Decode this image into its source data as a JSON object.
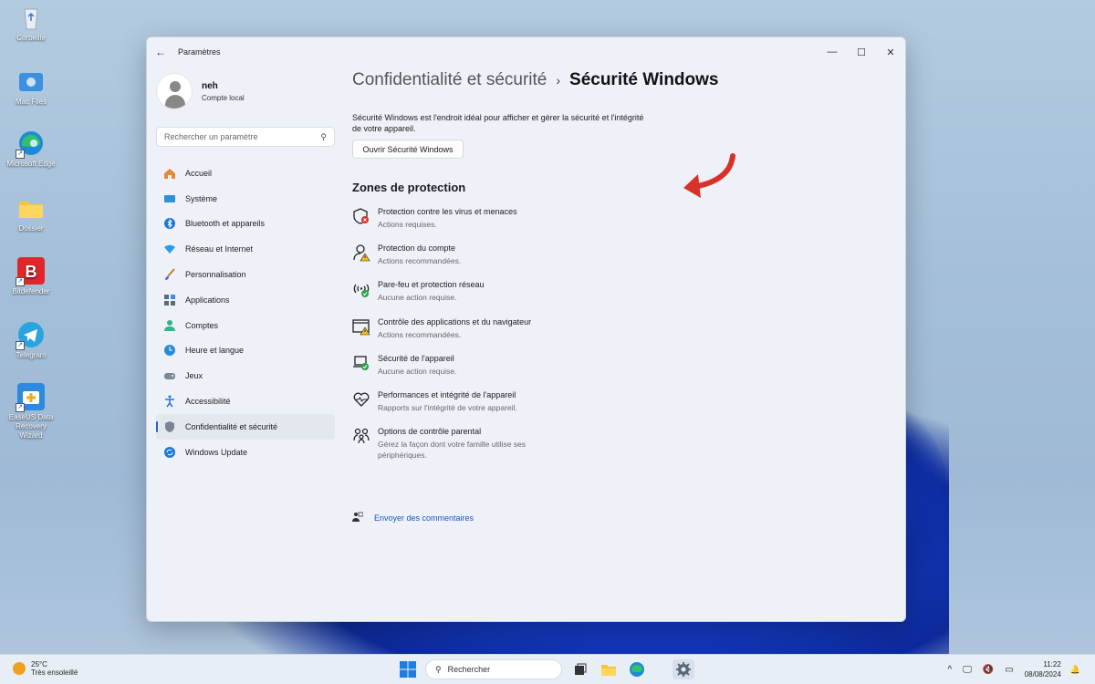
{
  "desktop": {
    "icons": [
      {
        "label": "Corbeille",
        "icon": "recycle-bin-icon"
      },
      {
        "label": "Mac Files",
        "icon": "folder-mac-icon"
      },
      {
        "label": "Microsoft Edge",
        "icon": "edge-icon"
      },
      {
        "label": "Dossier",
        "icon": "folder-icon"
      },
      {
        "label": "Bitdefender",
        "icon": "bitdefender-icon"
      },
      {
        "label": "Telegram",
        "icon": "telegram-icon"
      },
      {
        "label": "EaseUS Data Recovery Wizard",
        "icon": "easeus-icon"
      }
    ]
  },
  "window": {
    "title": "Paramètres",
    "back": "←",
    "controls": {
      "minimize": "—",
      "maximize": "☐",
      "close": "✕"
    }
  },
  "profile": {
    "name": "neh",
    "subtitle": "Compte local"
  },
  "search": {
    "placeholder": "Rechercher un paramètre"
  },
  "nav": [
    {
      "label": "Accueil",
      "icon": "home-icon"
    },
    {
      "label": "Système",
      "icon": "system-icon"
    },
    {
      "label": "Bluetooth et appareils",
      "icon": "bluetooth-icon"
    },
    {
      "label": "Réseau et Internet",
      "icon": "wifi-icon"
    },
    {
      "label": "Personnalisation",
      "icon": "brush-icon"
    },
    {
      "label": "Applications",
      "icon": "apps-icon"
    },
    {
      "label": "Comptes",
      "icon": "person-icon"
    },
    {
      "label": "Heure et langue",
      "icon": "globe-clock-icon"
    },
    {
      "label": "Jeux",
      "icon": "gamepad-icon"
    },
    {
      "label": "Accessibilité",
      "icon": "accessibility-icon"
    },
    {
      "label": "Confidentialité et sécurité",
      "icon": "shield-icon",
      "active": true
    },
    {
      "label": "Windows Update",
      "icon": "update-icon"
    }
  ],
  "main": {
    "breadcrumb_parent": "Confidentialité et sécurité",
    "breadcrumb_sep": "›",
    "breadcrumb_current": "Sécurité Windows",
    "description": "Sécurité Windows est l'endroit idéal pour afficher et gérer la sécurité et l'intégrité de votre appareil.",
    "open_button": "Ouvrir Sécurité Windows",
    "section_title": "Zones de protection",
    "zones": [
      {
        "title": "Protection contre les virus et menaces",
        "status": "Actions requises.",
        "icon": "virus-shield-icon"
      },
      {
        "title": "Protection du compte",
        "status": "Actions recommandées.",
        "icon": "account-protection-icon"
      },
      {
        "title": "Pare-feu et protection réseau",
        "status": "Aucune action requise.",
        "icon": "firewall-icon"
      },
      {
        "title": "Contrôle des applications et du navigateur",
        "status": "Actions recommandées.",
        "icon": "app-browser-icon"
      },
      {
        "title": "Sécurité de l'appareil",
        "status": "Aucune action requise.",
        "icon": "device-security-icon"
      },
      {
        "title": "Performances et intégrité de l'appareil",
        "status": "Rapports sur l'intégrité de votre appareil.",
        "icon": "heart-icon"
      },
      {
        "title": "Options de contrôle parental",
        "status": "Gérez la façon dont votre famille utilise ses périphériques.",
        "icon": "family-icon"
      }
    ],
    "feedback": "Envoyer des commentaires"
  },
  "taskbar": {
    "weather_temp": "25°C",
    "weather_desc": "Très ensoleillé",
    "search": "Rechercher",
    "time": "11:22",
    "date": "08/08/2024"
  },
  "colors": {
    "accent": "#2c5fd0",
    "arrow": "#d9302a",
    "link": "#1a56b8"
  }
}
